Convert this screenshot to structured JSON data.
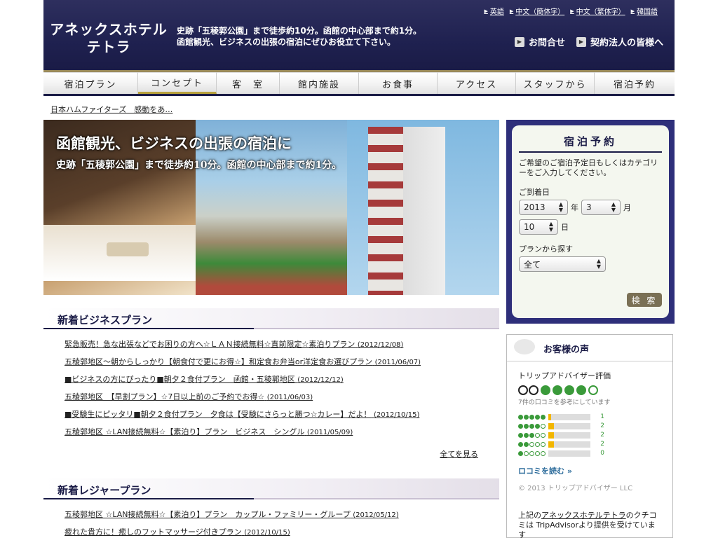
{
  "header": {
    "logo_line1": "アネックスホテル",
    "logo_line2": "テトラ",
    "tagline_line1": "史跡「五稜郭公園」まで徒歩約10分。函館の中心部まで約1分。",
    "tagline_line2": "函館観光、ビジネスの出張の宿泊にぜひお役立て下さい。",
    "languages": [
      "英語",
      "中文（簡体字）",
      "中文（繁体字）",
      "韓国語"
    ],
    "btn_contact": "お問合せ",
    "btn_corporate": "契約法人の皆様へ"
  },
  "nav": [
    "宿泊プラン",
    "コンセプト",
    "客　室",
    "館内施設",
    "お食事",
    "アクセス",
    "スタッフから",
    "宿泊予約"
  ],
  "ticker": "日本ハムファイターズ　感動をあ…",
  "hero": {
    "line1": "函館観光、ビジネスの出張の宿泊に",
    "line2": "史跡「五稜郭公園」まで徒歩約10分。函館の中心部まで約1分。"
  },
  "reservation": {
    "title": "宿泊予約",
    "description": "ご希望のご宿泊予定日もしくはカテゴリーをご入力してください。",
    "arrival_label": "ご到着日",
    "year": "2013",
    "year_unit": "年",
    "month": "3",
    "month_unit": "月",
    "day": "10",
    "day_unit": "日",
    "plan_label": "プランから探す",
    "plan_value": "全て",
    "search_label": "検 索"
  },
  "business": {
    "title": "新着ビジネスプラン",
    "items": [
      {
        "text": "緊急販売！急な出張などでお困りの方へ☆ＬＡＮ接続無料☆直前限定☆素泊りプラン",
        "date": "(2012/12/08)"
      },
      {
        "text": "五稜郭地区～朝からしっかり【朝食付で更にお得☆】和定食お弁当or洋定食お選びプラン",
        "date": "(2011/06/07)"
      },
      {
        "text": "■ビジネスの方にぴったり■朝夕２食付プラン　函館・五稜郭地区",
        "date": "(2012/12/12)"
      },
      {
        "text": "五稜郭地区　【早割プラン】☆7日以上前のご予約でお得☆",
        "date": "(2011/06/03)"
      },
      {
        "text": "■受験生にピッタリ■朝夕２食付プラン　夕食は【受験にさらっと勝つ☆カレー】だよ！",
        "date": "(2012/10/15)"
      },
      {
        "text": "五稜郭地区 ☆LAN接続無料☆【素泊り】プラン　ビジネス　シングル",
        "date": "(2011/05/09)"
      }
    ],
    "more": "全てを見る"
  },
  "leisure": {
    "title": "新着レジャープラン",
    "items": [
      {
        "text": "五稜郭地区 ☆LAN接続無料☆【素泊り】プラン　カップル・ファミリー・グループ",
        "date": "(2012/05/12)"
      },
      {
        "text": "疲れた貴方に！癒しのフットマッサージ付きプラン",
        "date": "(2012/10/15)"
      }
    ]
  },
  "voice": {
    "title": "お客様の声",
    "rating_label": "トリップアドバイザー評価",
    "rating": 4,
    "review_count_text": "7件の口コミを参考にしています",
    "distribution": [
      {
        "stars": 5,
        "count": "1",
        "fraction": 0.14
      },
      {
        "stars": 4,
        "count": "2",
        "fraction": 0.28
      },
      {
        "stars": 3,
        "count": "2",
        "fraction": 0.28
      },
      {
        "stars": 2,
        "count": "2",
        "fraction": 0.28
      },
      {
        "stars": 1,
        "count": "0",
        "fraction": 0
      }
    ],
    "read_reviews": "ロコミを読む »",
    "copyright": "© 2013 トリップアドバイザー LLC",
    "note_pre": "上記の",
    "note_link": "アネックスホテルテトラ",
    "note_post": "のクチコミは TripAdvisorより提供を受けています"
  }
}
